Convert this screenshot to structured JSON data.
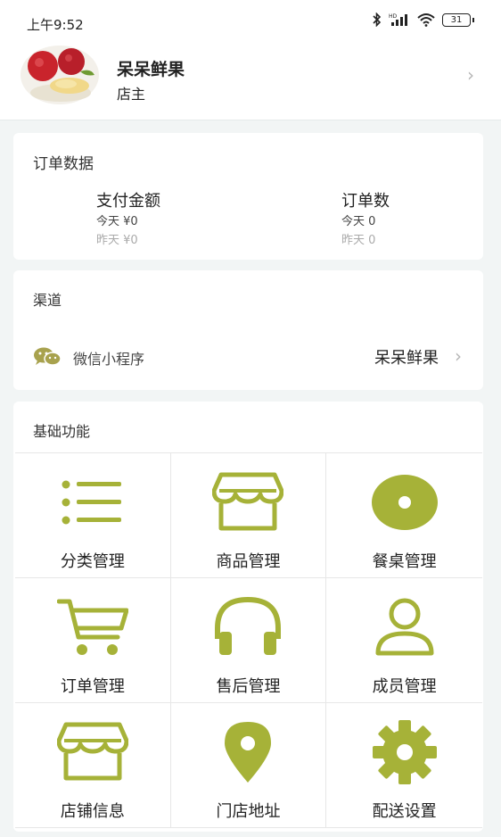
{
  "status_bar": {
    "time": "上午9:52",
    "battery": "31"
  },
  "profile": {
    "shop_name": "呆呆鲜果",
    "role": "店主"
  },
  "order_data": {
    "title": "订单数据",
    "stats": [
      {
        "title": "支付金额",
        "today": "今天 ¥0",
        "yesterday": "昨天 ¥0"
      },
      {
        "title": "订单数",
        "today": "今天 0",
        "yesterday": "昨天 0"
      }
    ]
  },
  "channel": {
    "title": "渠道",
    "name": "微信小程序",
    "value": "呆呆鲜果"
  },
  "functions": {
    "title": "基础功能",
    "items": [
      {
        "label": "分类管理",
        "icon": "list-icon"
      },
      {
        "label": "商品管理",
        "icon": "storefront-icon"
      },
      {
        "label": "餐桌管理",
        "icon": "disc-icon"
      },
      {
        "label": "订单管理",
        "icon": "cart-icon"
      },
      {
        "label": "售后管理",
        "icon": "headphones-icon"
      },
      {
        "label": "成员管理",
        "icon": "person-icon"
      },
      {
        "label": "店铺信息",
        "icon": "storefront-icon"
      },
      {
        "label": "门店地址",
        "icon": "location-pin-icon"
      },
      {
        "label": "配送设置",
        "icon": "gear-icon"
      }
    ]
  },
  "colors": {
    "accent": "#a6b238",
    "wechat": "#a8a24e",
    "background": "#f2f5f5"
  }
}
